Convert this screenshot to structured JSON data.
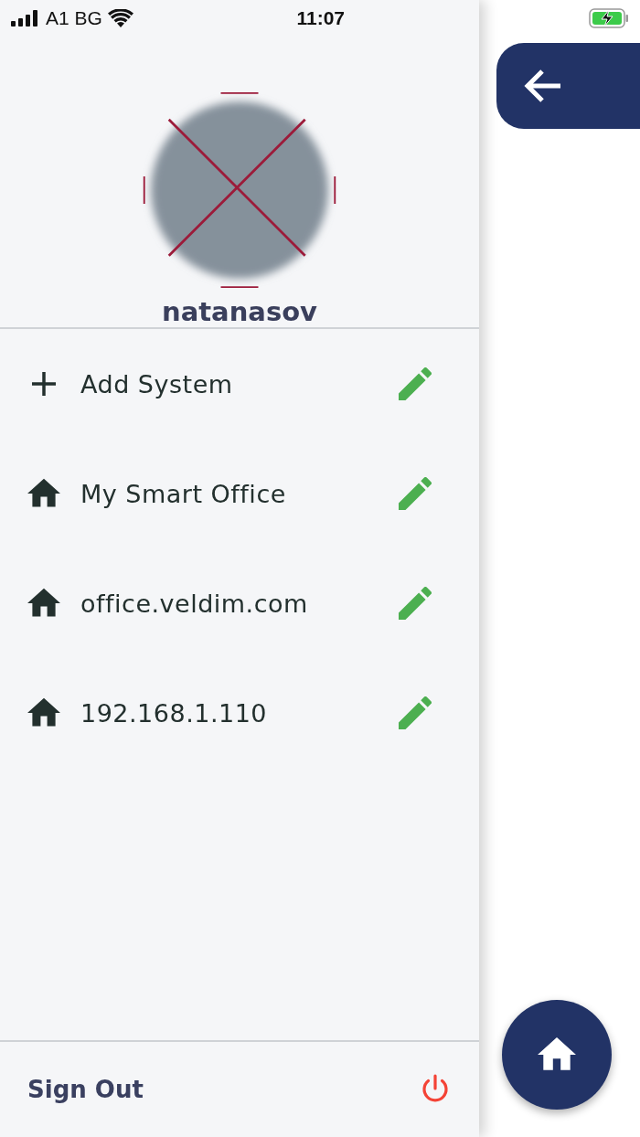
{
  "status_bar": {
    "carrier": "A1 BG",
    "time": "11:07"
  },
  "user": {
    "name": "natanasov"
  },
  "systems": [
    {
      "kind": "add",
      "label": "Add System"
    },
    {
      "kind": "system",
      "label": "My Smart Office"
    },
    {
      "kind": "system",
      "label": "office.veldim.com"
    },
    {
      "kind": "system",
      "label": "192.168.1.110"
    }
  ],
  "footer": {
    "sign_out": "Sign Out"
  }
}
